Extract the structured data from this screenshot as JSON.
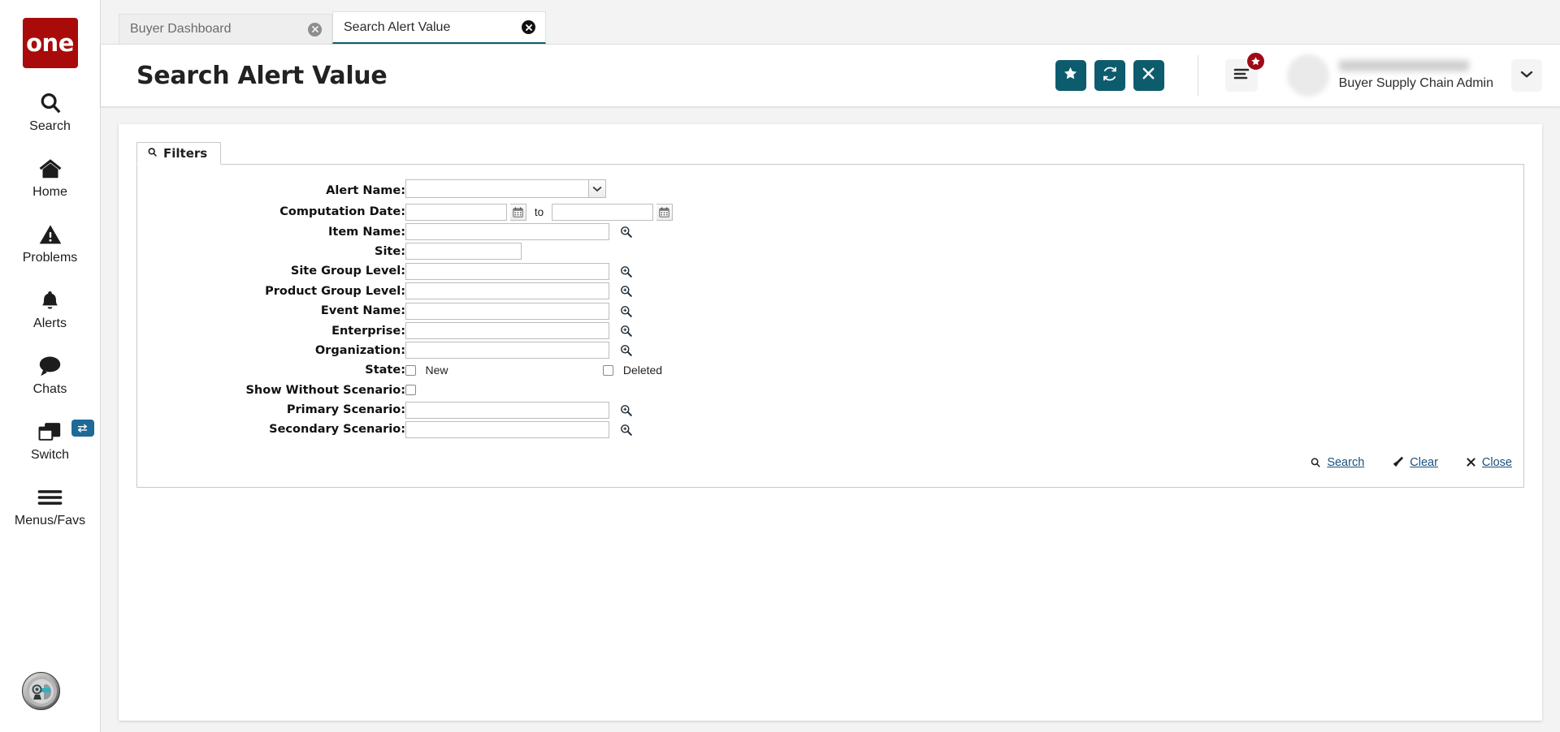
{
  "brand": {
    "logo_text": "one",
    "logo_color": "#a90b0b"
  },
  "accent": {
    "teal": "#0d5c6e",
    "link": "#1c4f7c",
    "badge_red": "#9e0b16"
  },
  "sidebar": {
    "items": [
      {
        "label": "Search",
        "icon": "search-icon"
      },
      {
        "label": "Home",
        "icon": "home-icon"
      },
      {
        "label": "Problems",
        "icon": "warning-triangle-icon"
      },
      {
        "label": "Alerts",
        "icon": "bell-icon"
      },
      {
        "label": "Chats",
        "icon": "chat-bubble-icon"
      },
      {
        "label": "Switch",
        "icon": "switch-windows-icon",
        "badge_icon": "swap-arrows-icon"
      },
      {
        "label": "Menus/Favs",
        "icon": "hamburger-icon"
      }
    ],
    "bottom_avatar_icon": "ai-assistant-avatar-icon"
  },
  "tabs": [
    {
      "label": "Buyer Dashboard",
      "active": false,
      "close_icon": "close-circle-icon"
    },
    {
      "label": "Search Alert Value",
      "active": true,
      "close_icon": "close-circle-icon"
    }
  ],
  "header": {
    "title": "Search Alert Value",
    "buttons": [
      {
        "name": "favorite",
        "icon": "star-icon"
      },
      {
        "name": "refresh",
        "icon": "refresh-icon"
      },
      {
        "name": "close",
        "icon": "x-icon"
      }
    ],
    "menu_button": {
      "icon": "menu-lines-icon",
      "badge_icon": "star-icon"
    },
    "user": {
      "name_masked": "",
      "role": "Buyer Supply Chain Admin",
      "caret_icon": "chevron-down-icon"
    }
  },
  "filters": {
    "tab_label": "Filters",
    "tab_icon": "search-icon",
    "rows": [
      {
        "label": "Alert Name:",
        "type": "select",
        "value": "",
        "name": "alert-name"
      },
      {
        "label": "Computation Date:",
        "type": "date-range",
        "value_from": "",
        "value_to": "",
        "separator": "to",
        "name": "computation-date"
      },
      {
        "label": "Item Name:",
        "type": "lookup",
        "value": "",
        "name": "item-name"
      },
      {
        "label": "Site:",
        "type": "text-narrow",
        "value": "",
        "name": "site"
      },
      {
        "label": "Site Group Level:",
        "type": "lookup",
        "value": "",
        "name": "site-group-level"
      },
      {
        "label": "Product Group Level:",
        "type": "lookup",
        "value": "",
        "name": "product-group-level"
      },
      {
        "label": "Event Name:",
        "type": "lookup",
        "value": "",
        "name": "event-name"
      },
      {
        "label": "Enterprise:",
        "type": "lookup",
        "value": "",
        "name": "enterprise"
      },
      {
        "label": "Organization:",
        "type": "lookup",
        "value": "",
        "name": "organization"
      },
      {
        "label": "State:",
        "type": "checkbox-pair",
        "checkbox1_label": "New",
        "checkbox1_checked": false,
        "checkbox2_label": "Deleted",
        "checkbox2_checked": false,
        "name": "state"
      },
      {
        "label": "Show Without Scenario:",
        "type": "checkbox",
        "checked": false,
        "name": "show-without-scenario"
      },
      {
        "label": "Primary Scenario:",
        "type": "lookup",
        "value": "",
        "name": "primary-scenario"
      },
      {
        "label": "Secondary Scenario:",
        "type": "lookup",
        "value": "",
        "name": "secondary-scenario"
      }
    ],
    "actions": [
      {
        "label": "Search",
        "icon": "search-icon",
        "name": "search"
      },
      {
        "label": "Clear",
        "icon": "broom-icon",
        "name": "clear"
      },
      {
        "label": "Close",
        "icon": "x-icon",
        "name": "close"
      }
    ]
  }
}
